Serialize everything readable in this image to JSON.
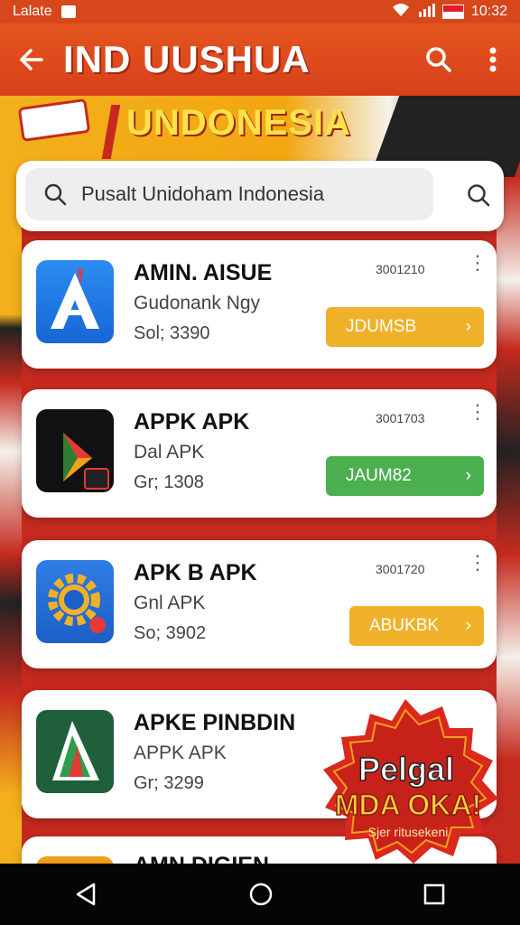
{
  "status_bar": {
    "left_text": "Lalate",
    "time": "10:32"
  },
  "app_bar": {
    "title": "IND UUSHUA"
  },
  "banner": {
    "emblem": "",
    "text": "UNDONESIA"
  },
  "search": {
    "value": "Pusalt Unidoham Indonesia"
  },
  "apps": [
    {
      "name": "AMIN. AISUE",
      "subtitle": "Gudonank Ngy",
      "size": "Sol; 3390",
      "number": "3001210",
      "button": "JDUMSB",
      "button_color": "#f0b12a",
      "icon": "blue-a-icon"
    },
    {
      "name": "APPK APK",
      "subtitle": "Dal APK",
      "size": "Gr; 1308",
      "number": "3001703",
      "button": "JAUM82",
      "button_color": "#4caf50",
      "icon": "dark-play-icon"
    },
    {
      "name": "APK B APK",
      "subtitle": "Gnl APK",
      "size": "So; 3902",
      "number": "3001720",
      "button": "ABUKBK",
      "button_color": "#f0b12a",
      "icon": "gear-icon"
    },
    {
      "name": "APKE PINBDIN",
      "subtitle": "APPK APK",
      "size": "Gr; 3299",
      "number": "",
      "button": "",
      "button_color": "",
      "icon": "green-a-icon"
    },
    {
      "name": "AMN DIGIEN",
      "subtitle": "",
      "size": "",
      "number": "",
      "button": "",
      "button_color": "",
      "icon": "orange-icon"
    }
  ],
  "promo": {
    "line1": "Pelgal",
    "line2": "MDA OKA!",
    "line3": "Sjer ritusekeni"
  }
}
